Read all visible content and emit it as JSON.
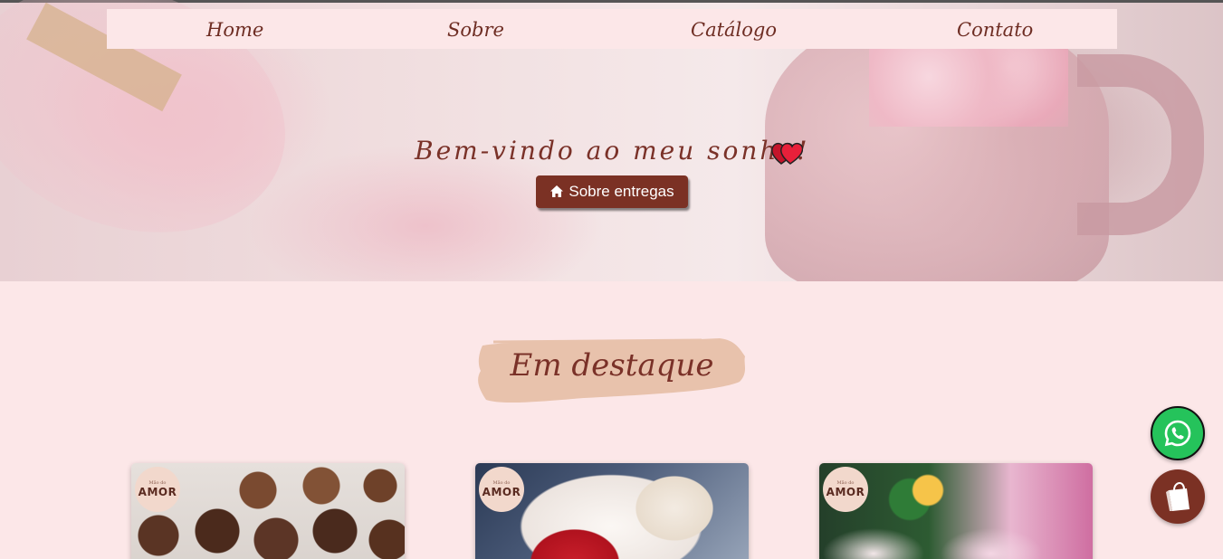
{
  "nav": {
    "items": [
      {
        "label": "Home"
      },
      {
        "label": "Sobre"
      },
      {
        "label": "Catálogo"
      },
      {
        "label": "Contato"
      }
    ]
  },
  "hero": {
    "title": "Bem-vindo ao meu sonho!",
    "button_label": "Sobre entregas",
    "button_icon": "home-icon",
    "title_icon": "hearts-icon"
  },
  "featured": {
    "title": "Em destaque",
    "cards": [
      {
        "logo_text": "AMOR",
        "logo_subtext": "Mão do",
        "image": "brigadeiros"
      },
      {
        "logo_text": "AMOR",
        "logo_subtext": "Mão do",
        "image": "strawberry-cake-and-eclairs"
      },
      {
        "logo_text": "AMOR",
        "logo_subtext": "Mão do",
        "image": "meringue-cookies"
      }
    ]
  },
  "fabs": {
    "whatsapp_icon": "whatsapp-icon",
    "cart_icon": "shopping-bag-icon"
  },
  "colors": {
    "accent": "#7b3124",
    "background": "#fce7e8",
    "whatsapp": "#25c35b",
    "brush": "#e8c2ac"
  }
}
